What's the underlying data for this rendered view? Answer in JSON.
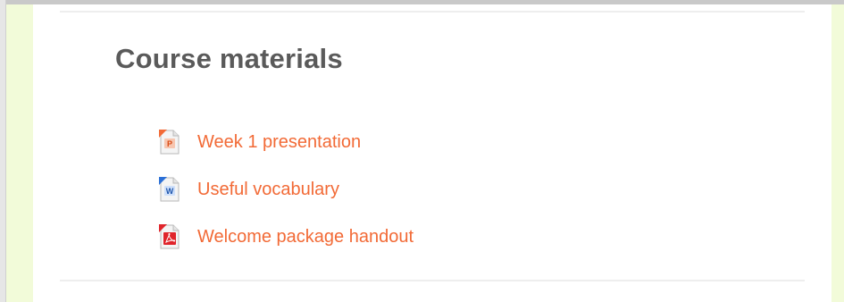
{
  "section": {
    "title": "Course materials"
  },
  "activities": [
    {
      "label": "Week 1 presentation",
      "icon": "powerpoint-file-icon",
      "icon_color": "#f26a36",
      "icon_letter": "P"
    },
    {
      "label": "Useful vocabulary",
      "icon": "word-file-icon",
      "icon_color": "#2b6fd6",
      "icon_letter": "W"
    },
    {
      "label": "Welcome package handout",
      "icon": "pdf-file-icon",
      "icon_color": "#e0242b",
      "icon_letter": ""
    }
  ],
  "colors": {
    "link": "#f26a36",
    "title": "#5a5a5a",
    "sidebar": "#f2fbd9"
  }
}
